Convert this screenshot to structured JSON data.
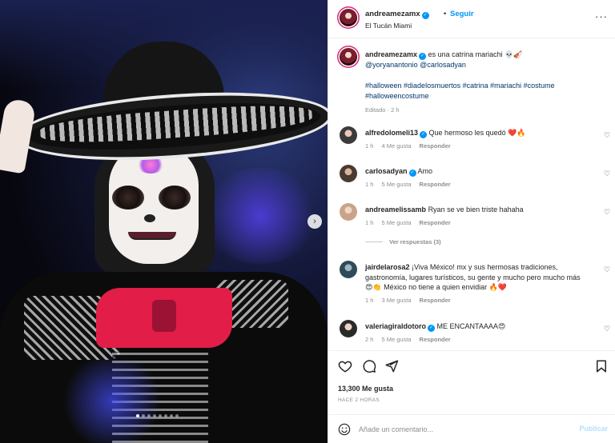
{
  "author": {
    "username": "andreamezamx",
    "follow_label": "Seguir",
    "location": "El Tucán Miami"
  },
  "caption": {
    "username": "andreamezamx",
    "text": "es una catrina mariachi 💀🎻",
    "mentions": "@yoryanantonio @carlosadyan",
    "hashtags": "#halloween #diadelosmuertos #catrina #mariachi #costume #halloweencostume",
    "edited": "Editado · 2 h"
  },
  "comments": [
    {
      "username": "alfredolomeli13",
      "verified": true,
      "text": "Que hermoso les quedó ❤️🔥",
      "time": "1 h",
      "likes": "4 Me gusta",
      "reply": "Responder",
      "avatar_color": "#3b3b3b"
    },
    {
      "username": "carlosadyan",
      "verified": true,
      "text": "Amo",
      "time": "1 h",
      "likes": "5 Me gusta",
      "reply": "Responder",
      "avatar_color": "#4a3a32"
    },
    {
      "username": "andreamelissamb",
      "verified": false,
      "text": "Ryan se ve bien triste hahaha",
      "time": "1 h",
      "likes": "5 Me gusta",
      "reply": "Responder",
      "avatar_color": "#c9a48a"
    },
    {
      "username": "jairdelarosa2",
      "verified": false,
      "text": "¡Viva México! mx y sus hermosas tradiciones, gastronomía, lugares turísticos, su gente y mucho pero mucho más 😍👏 México no tiene a quien envidiar 🔥❤️",
      "time": "1 h",
      "likes": "3 Me gusta",
      "reply": "Responder",
      "avatar_color": "#2f4a58"
    },
    {
      "username": "valeriagiraldotoro",
      "verified": true,
      "text": "ME ENCANTAAAA😍",
      "time": "2 h",
      "likes": "5 Me gusta",
      "reply": "Responder",
      "avatar_color": "#2a2a2a"
    }
  ],
  "view_replies": "Ver respuestas (3)",
  "stats": {
    "likes": "13,300 Me gusta",
    "time": "HACE 2 HORAS"
  },
  "add_comment": {
    "placeholder": "Añade un comentario...",
    "publish": "Publicar"
  },
  "icons": {
    "verified": "✓",
    "more": "···",
    "next": "›",
    "heart_small": "♡"
  },
  "colors": {
    "accent": "#0095f6",
    "link": "#00376b",
    "muted": "#8e8e8e"
  }
}
